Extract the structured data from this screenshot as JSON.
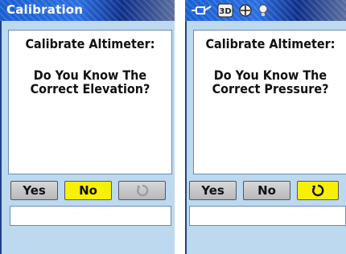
{
  "left_screen": {
    "title": "Calibration",
    "prompt_line1": "Calibrate Altimeter:",
    "prompt_line2": "Do You Know The\nCorrect Elevation?",
    "buttons": {
      "yes": "Yes",
      "no": "No"
    },
    "selected_button": "No",
    "field_value": ""
  },
  "right_screen": {
    "status_icons": [
      "battery-icon",
      "3d-fix-icon",
      "satellite-icon",
      "backlight-icon"
    ],
    "status_3d_label": "3D",
    "prompt_line1": "Calibrate Altimeter:",
    "prompt_line2": "Do You Know The\nCorrect Pressure?",
    "buttons": {
      "yes": "Yes",
      "no": "No"
    },
    "selected_button": "next",
    "field_value": ""
  },
  "colors": {
    "title_blue": "#1a5fd0",
    "selected": "#f7f000",
    "background": "#bcd9f0"
  }
}
